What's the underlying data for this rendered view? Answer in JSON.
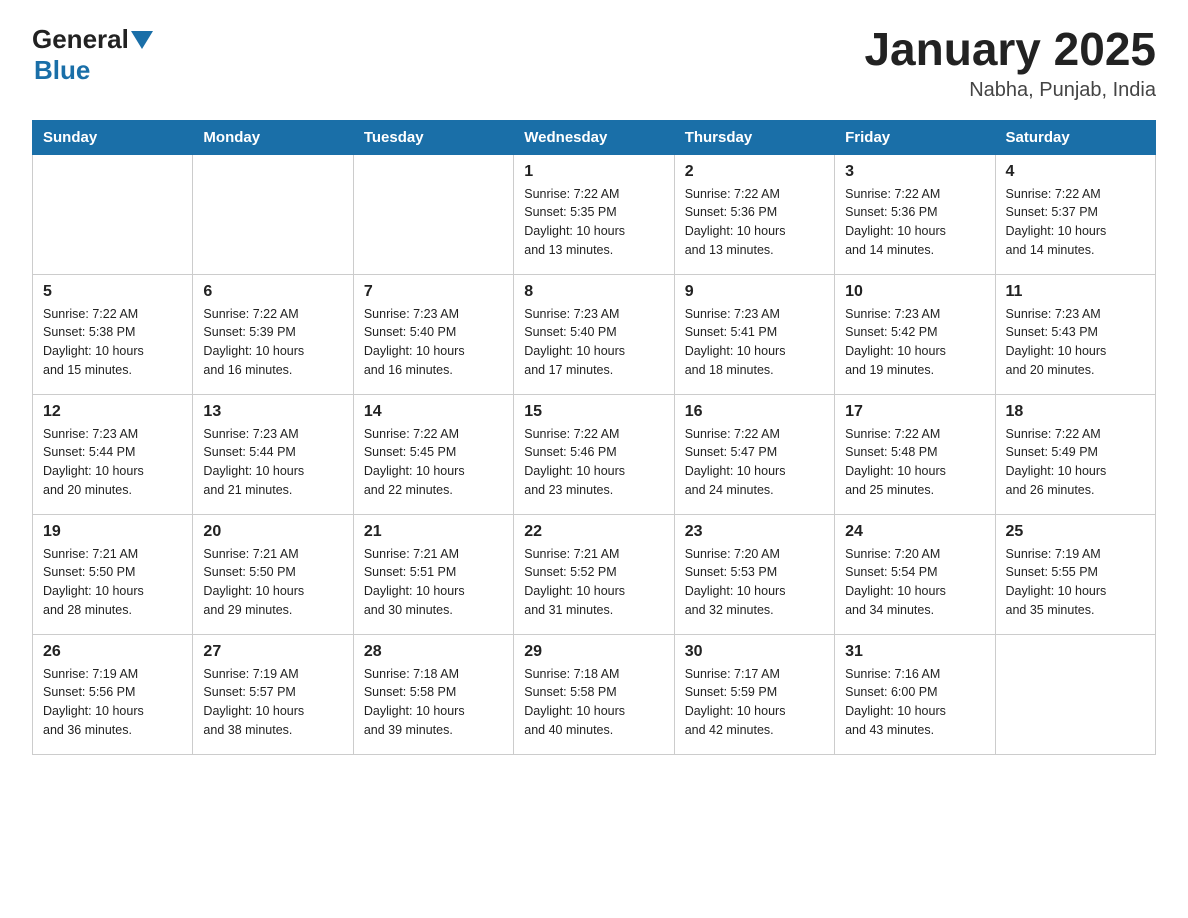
{
  "header": {
    "logo": {
      "general": "General",
      "blue": "Blue"
    },
    "title": "January 2025",
    "subtitle": "Nabha, Punjab, India"
  },
  "weekdays": [
    "Sunday",
    "Monday",
    "Tuesday",
    "Wednesday",
    "Thursday",
    "Friday",
    "Saturday"
  ],
  "weeks": [
    [
      {
        "day": "",
        "info": ""
      },
      {
        "day": "",
        "info": ""
      },
      {
        "day": "",
        "info": ""
      },
      {
        "day": "1",
        "info": "Sunrise: 7:22 AM\nSunset: 5:35 PM\nDaylight: 10 hours\nand 13 minutes."
      },
      {
        "day": "2",
        "info": "Sunrise: 7:22 AM\nSunset: 5:36 PM\nDaylight: 10 hours\nand 13 minutes."
      },
      {
        "day": "3",
        "info": "Sunrise: 7:22 AM\nSunset: 5:36 PM\nDaylight: 10 hours\nand 14 minutes."
      },
      {
        "day": "4",
        "info": "Sunrise: 7:22 AM\nSunset: 5:37 PM\nDaylight: 10 hours\nand 14 minutes."
      }
    ],
    [
      {
        "day": "5",
        "info": "Sunrise: 7:22 AM\nSunset: 5:38 PM\nDaylight: 10 hours\nand 15 minutes."
      },
      {
        "day": "6",
        "info": "Sunrise: 7:22 AM\nSunset: 5:39 PM\nDaylight: 10 hours\nand 16 minutes."
      },
      {
        "day": "7",
        "info": "Sunrise: 7:23 AM\nSunset: 5:40 PM\nDaylight: 10 hours\nand 16 minutes."
      },
      {
        "day": "8",
        "info": "Sunrise: 7:23 AM\nSunset: 5:40 PM\nDaylight: 10 hours\nand 17 minutes."
      },
      {
        "day": "9",
        "info": "Sunrise: 7:23 AM\nSunset: 5:41 PM\nDaylight: 10 hours\nand 18 minutes."
      },
      {
        "day": "10",
        "info": "Sunrise: 7:23 AM\nSunset: 5:42 PM\nDaylight: 10 hours\nand 19 minutes."
      },
      {
        "day": "11",
        "info": "Sunrise: 7:23 AM\nSunset: 5:43 PM\nDaylight: 10 hours\nand 20 minutes."
      }
    ],
    [
      {
        "day": "12",
        "info": "Sunrise: 7:23 AM\nSunset: 5:44 PM\nDaylight: 10 hours\nand 20 minutes."
      },
      {
        "day": "13",
        "info": "Sunrise: 7:23 AM\nSunset: 5:44 PM\nDaylight: 10 hours\nand 21 minutes."
      },
      {
        "day": "14",
        "info": "Sunrise: 7:22 AM\nSunset: 5:45 PM\nDaylight: 10 hours\nand 22 minutes."
      },
      {
        "day": "15",
        "info": "Sunrise: 7:22 AM\nSunset: 5:46 PM\nDaylight: 10 hours\nand 23 minutes."
      },
      {
        "day": "16",
        "info": "Sunrise: 7:22 AM\nSunset: 5:47 PM\nDaylight: 10 hours\nand 24 minutes."
      },
      {
        "day": "17",
        "info": "Sunrise: 7:22 AM\nSunset: 5:48 PM\nDaylight: 10 hours\nand 25 minutes."
      },
      {
        "day": "18",
        "info": "Sunrise: 7:22 AM\nSunset: 5:49 PM\nDaylight: 10 hours\nand 26 minutes."
      }
    ],
    [
      {
        "day": "19",
        "info": "Sunrise: 7:21 AM\nSunset: 5:50 PM\nDaylight: 10 hours\nand 28 minutes."
      },
      {
        "day": "20",
        "info": "Sunrise: 7:21 AM\nSunset: 5:50 PM\nDaylight: 10 hours\nand 29 minutes."
      },
      {
        "day": "21",
        "info": "Sunrise: 7:21 AM\nSunset: 5:51 PM\nDaylight: 10 hours\nand 30 minutes."
      },
      {
        "day": "22",
        "info": "Sunrise: 7:21 AM\nSunset: 5:52 PM\nDaylight: 10 hours\nand 31 minutes."
      },
      {
        "day": "23",
        "info": "Sunrise: 7:20 AM\nSunset: 5:53 PM\nDaylight: 10 hours\nand 32 minutes."
      },
      {
        "day": "24",
        "info": "Sunrise: 7:20 AM\nSunset: 5:54 PM\nDaylight: 10 hours\nand 34 minutes."
      },
      {
        "day": "25",
        "info": "Sunrise: 7:19 AM\nSunset: 5:55 PM\nDaylight: 10 hours\nand 35 minutes."
      }
    ],
    [
      {
        "day": "26",
        "info": "Sunrise: 7:19 AM\nSunset: 5:56 PM\nDaylight: 10 hours\nand 36 minutes."
      },
      {
        "day": "27",
        "info": "Sunrise: 7:19 AM\nSunset: 5:57 PM\nDaylight: 10 hours\nand 38 minutes."
      },
      {
        "day": "28",
        "info": "Sunrise: 7:18 AM\nSunset: 5:58 PM\nDaylight: 10 hours\nand 39 minutes."
      },
      {
        "day": "29",
        "info": "Sunrise: 7:18 AM\nSunset: 5:58 PM\nDaylight: 10 hours\nand 40 minutes."
      },
      {
        "day": "30",
        "info": "Sunrise: 7:17 AM\nSunset: 5:59 PM\nDaylight: 10 hours\nand 42 minutes."
      },
      {
        "day": "31",
        "info": "Sunrise: 7:16 AM\nSunset: 6:00 PM\nDaylight: 10 hours\nand 43 minutes."
      },
      {
        "day": "",
        "info": ""
      }
    ]
  ]
}
